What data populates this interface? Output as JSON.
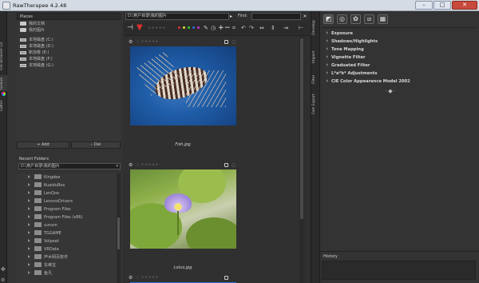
{
  "window": {
    "title": "RawTherapee 4.2.48",
    "min": "–",
    "max": "□",
    "close": "✕"
  },
  "left_tabs": [
    "File Browser (2)",
    "Queue",
    "Editor"
  ],
  "places": {
    "header": "Places",
    "items": [
      {
        "label": "我的文档",
        "icon": "folder-icon"
      },
      {
        "label": "我的图片",
        "icon": "folder-icon"
      },
      {
        "label": "本地磁盘 (C:)",
        "icon": "drive-icon"
      },
      {
        "label": "本地磁盘 (D:)",
        "icon": "drive-icon"
      },
      {
        "label": "新加卷 (E:)",
        "icon": "drive-icon"
      },
      {
        "label": "本地磁盘 (F:)",
        "icon": "drive-icon"
      },
      {
        "label": "本地磁盘 (G:)",
        "icon": "drive-icon"
      }
    ],
    "add_label": "Add",
    "del_label": "Del"
  },
  "recent": {
    "header": "Recent Folders",
    "value": "D:\\用户目录\\我的图片",
    "tree": [
      "Kingdee",
      "KuaiduBox",
      "LenQoo",
      "LenovoDrivers",
      "Program Files",
      "Program Files (x86)",
      "sunxm",
      "TGGAME",
      "Volpeet",
      "VRData",
      "芦木网页软件",
      "东维宝",
      "鱼凡"
    ]
  },
  "browser": {
    "path": "D:\\用户目录\\我的图片",
    "find_label": "Find:",
    "thumbs": [
      {
        "caption": "Fish.jpg"
      },
      {
        "caption": "Lotus.jpg"
      }
    ]
  },
  "side_tabs": [
    "Develop",
    "Import",
    "Filter",
    "Fast Export"
  ],
  "tools": [
    "Exposure",
    "Shadows/Highlights",
    "Tone Mapping",
    "Vignette Filter",
    "Graduated Filter",
    "L*a*b* Adjustments",
    "CIE Color Appearance Model 2002"
  ],
  "history_label": "History",
  "colors": {
    "accent": "#2b6fd6",
    "panel": "#333333",
    "dark": "#2f2f2f"
  }
}
